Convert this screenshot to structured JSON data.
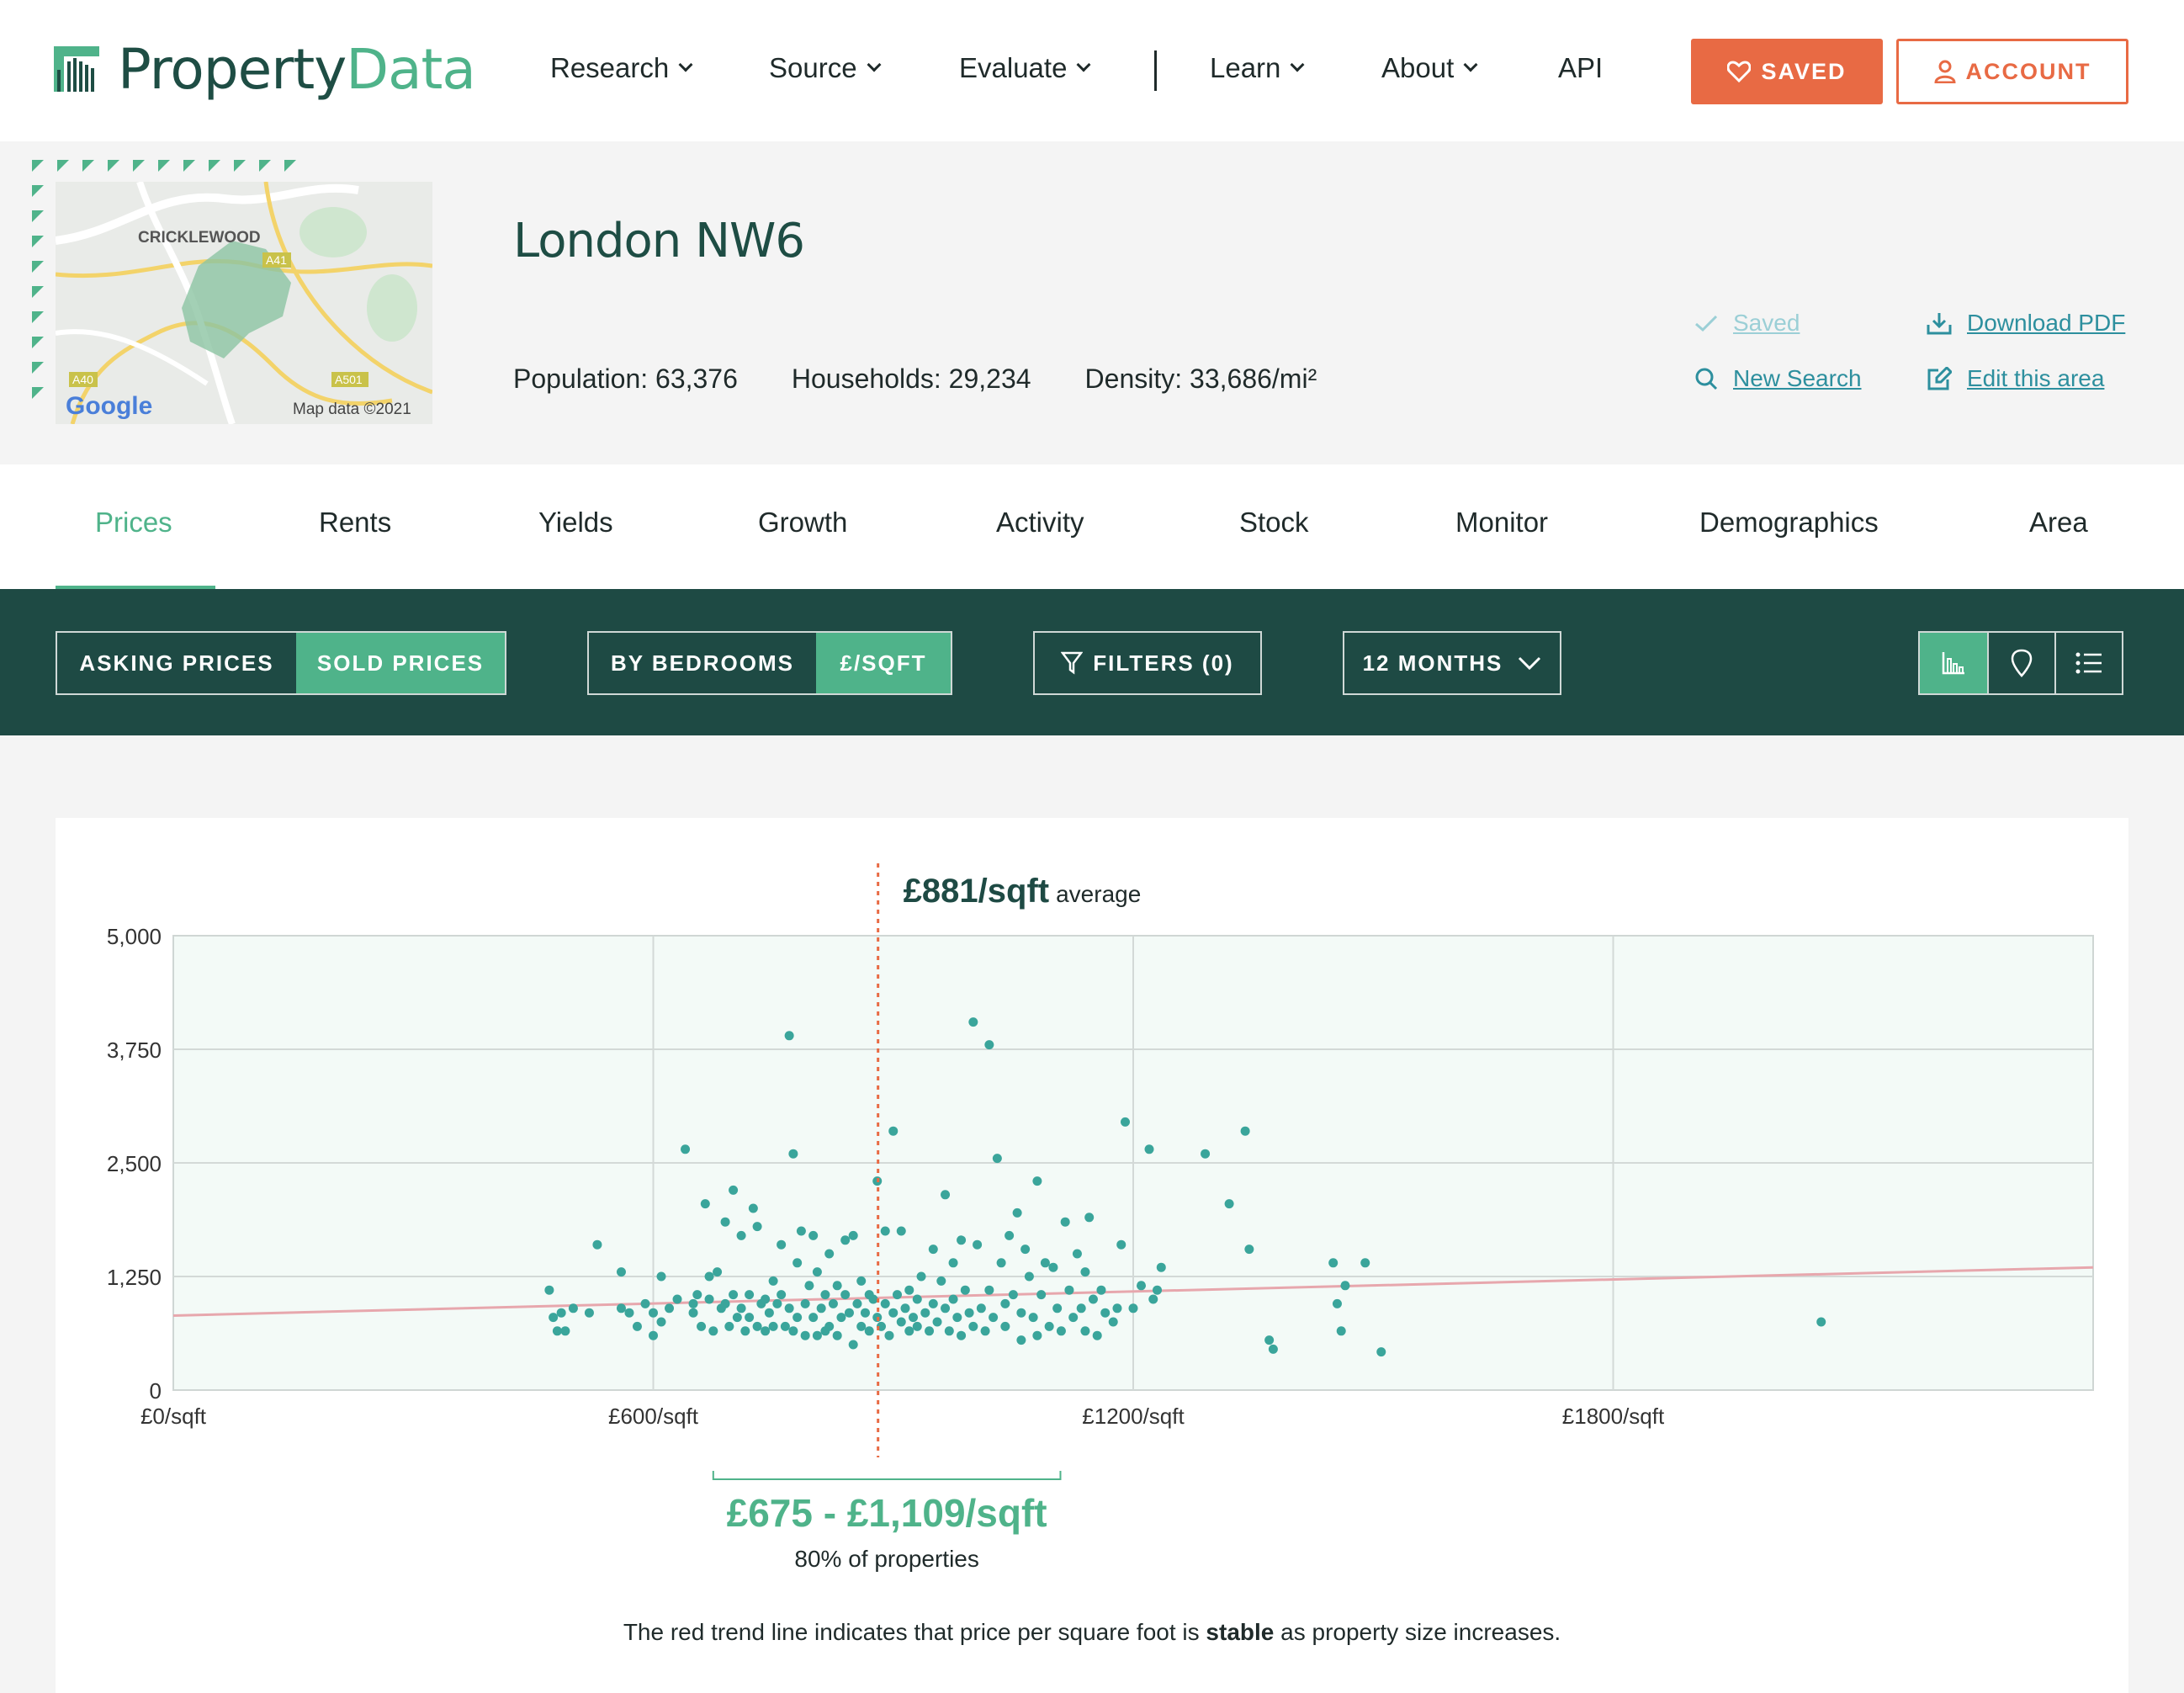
{
  "header": {
    "logo_part1": "Property",
    "logo_part2": "Data",
    "nav": [
      {
        "label": "Research",
        "has_dropdown": true
      },
      {
        "label": "Source",
        "has_dropdown": true
      },
      {
        "label": "Evaluate",
        "has_dropdown": true
      },
      {
        "label": "Learn",
        "has_dropdown": true
      },
      {
        "label": "About",
        "has_dropdown": true
      },
      {
        "label": "API",
        "has_dropdown": false
      }
    ],
    "saved_label": "SAVED",
    "account_label": "ACCOUNT",
    "accent_color": "#e86a44"
  },
  "area": {
    "title": "London NW6",
    "map_labels": {
      "place": "CRICKLEWOOD",
      "road1": "A41",
      "road2": "A40",
      "road3": "A501",
      "brand": "Google",
      "attribution": "Map data ©2021"
    },
    "stats": [
      {
        "label": "Population:",
        "value": "63,376"
      },
      {
        "label": "Households:",
        "value": "29,234"
      },
      {
        "label": "Density:",
        "value": "33,686/mi²"
      }
    ],
    "actions": {
      "saved": "Saved",
      "download_pdf": "Download PDF",
      "new_search": "New Search",
      "edit_area": "Edit this area"
    }
  },
  "tabs": [
    "Prices",
    "Rents",
    "Yields",
    "Growth",
    "Activity",
    "Stock",
    "Monitor",
    "Demographics",
    "Area"
  ],
  "active_tab": "Prices",
  "toolbar": {
    "price_type": {
      "options": [
        "ASKING PRICES",
        "SOLD PRICES"
      ],
      "selected": "SOLD PRICES"
    },
    "mode": {
      "options": [
        "BY BEDROOMS",
        "£/SQFT"
      ],
      "selected": "£/SQFT"
    },
    "filters_label": "FILTERS (0)",
    "period_label": "12 MONTHS",
    "views": [
      "chart-view-icon",
      "map-pin-icon",
      "list-view-icon"
    ],
    "active_view": "chart-view-icon",
    "bar_color": "#1e4a44",
    "active_color": "#4fb38a"
  },
  "chart": {
    "average_value": "£881/sqft",
    "average_suffix": "average",
    "range_label": "£675 - £1,109/sqft",
    "range_sub": "80% of properties",
    "trend_note_pre": "The red trend line indicates that price per square foot is ",
    "trend_note_bold": "stable",
    "trend_note_post": " as property size increases.",
    "y_ticks": [
      "5,000",
      "3,750",
      "2,500",
      "1,250",
      "0"
    ],
    "x_ticks": [
      "£0/sqft",
      "£600/sqft",
      "£1200/sqft",
      "£1800/sqft"
    ]
  },
  "chart_data": {
    "type": "scatter",
    "xlim": [
      0,
      2400
    ],
    "ylim": [
      0,
      5000
    ],
    "average_x": 881,
    "range": [
      675,
      1109
    ],
    "trend": {
      "x": [
        0,
        2400
      ],
      "y": [
        820,
        1350
      ]
    },
    "point_color": "#3aa59b",
    "trend_color": "#e7a7ad",
    "avg_line_color": "#e86a44",
    "points": [
      [
        470,
        1100
      ],
      [
        475,
        800
      ],
      [
        480,
        650
      ],
      [
        485,
        850
      ],
      [
        490,
        650
      ],
      [
        500,
        900
      ],
      [
        520,
        850
      ],
      [
        530,
        1600
      ],
      [
        560,
        1300
      ],
      [
        560,
        900
      ],
      [
        570,
        850
      ],
      [
        580,
        700
      ],
      [
        590,
        950
      ],
      [
        600,
        600
      ],
      [
        600,
        850
      ],
      [
        610,
        750
      ],
      [
        610,
        1250
      ],
      [
        620,
        900
      ],
      [
        630,
        1000
      ],
      [
        640,
        2650
      ],
      [
        650,
        950
      ],
      [
        650,
        850
      ],
      [
        655,
        1050
      ],
      [
        660,
        700
      ],
      [
        665,
        2050
      ],
      [
        670,
        1250
      ],
      [
        670,
        1000
      ],
      [
        675,
        650
      ],
      [
        680,
        1300
      ],
      [
        685,
        900
      ],
      [
        690,
        1850
      ],
      [
        690,
        950
      ],
      [
        695,
        700
      ],
      [
        700,
        1050
      ],
      [
        700,
        2200
      ],
      [
        705,
        800
      ],
      [
        710,
        1700
      ],
      [
        710,
        900
      ],
      [
        715,
        650
      ],
      [
        720,
        1050
      ],
      [
        720,
        800
      ],
      [
        725,
        2000
      ],
      [
        730,
        1800
      ],
      [
        730,
        700
      ],
      [
        735,
        950
      ],
      [
        740,
        1000
      ],
      [
        740,
        650
      ],
      [
        745,
        850
      ],
      [
        750,
        1200
      ],
      [
        750,
        700
      ],
      [
        755,
        950
      ],
      [
        760,
        1600
      ],
      [
        760,
        1050
      ],
      [
        765,
        700
      ],
      [
        770,
        900
      ],
      [
        770,
        3900
      ],
      [
        775,
        2600
      ],
      [
        775,
        650
      ],
      [
        780,
        1400
      ],
      [
        780,
        800
      ],
      [
        785,
        1750
      ],
      [
        790,
        600
      ],
      [
        790,
        950
      ],
      [
        795,
        1150
      ],
      [
        800,
        800
      ],
      [
        800,
        1700
      ],
      [
        805,
        1300
      ],
      [
        805,
        600
      ],
      [
        810,
        900
      ],
      [
        815,
        650
      ],
      [
        815,
        1050
      ],
      [
        820,
        1500
      ],
      [
        820,
        700
      ],
      [
        825,
        950
      ],
      [
        830,
        1150
      ],
      [
        830,
        600
      ],
      [
        835,
        800
      ],
      [
        840,
        1650
      ],
      [
        840,
        1050
      ],
      [
        845,
        850
      ],
      [
        850,
        1700
      ],
      [
        850,
        500
      ],
      [
        855,
        950
      ],
      [
        860,
        700
      ],
      [
        860,
        1200
      ],
      [
        865,
        850
      ],
      [
        870,
        1050
      ],
      [
        870,
        650
      ],
      [
        875,
        1000
      ],
      [
        880,
        800
      ],
      [
        880,
        2300
      ],
      [
        885,
        700
      ],
      [
        890,
        1750
      ],
      [
        890,
        950
      ],
      [
        895,
        600
      ],
      [
        900,
        850
      ],
      [
        900,
        2850
      ],
      [
        905,
        1050
      ],
      [
        910,
        750
      ],
      [
        910,
        1750
      ],
      [
        915,
        900
      ],
      [
        920,
        650
      ],
      [
        920,
        1100
      ],
      [
        925,
        800
      ],
      [
        930,
        1000
      ],
      [
        930,
        700
      ],
      [
        935,
        1250
      ],
      [
        940,
        850
      ],
      [
        945,
        650
      ],
      [
        950,
        950
      ],
      [
        950,
        1550
      ],
      [
        955,
        750
      ],
      [
        960,
        1200
      ],
      [
        965,
        900
      ],
      [
        965,
        2150
      ],
      [
        970,
        650
      ],
      [
        975,
        1400
      ],
      [
        975,
        1000
      ],
      [
        980,
        800
      ],
      [
        985,
        1650
      ],
      [
        985,
        600
      ],
      [
        990,
        1100
      ],
      [
        995,
        850
      ],
      [
        1000,
        700
      ],
      [
        1000,
        4050
      ],
      [
        1005,
        1600
      ],
      [
        1010,
        900
      ],
      [
        1015,
        650
      ],
      [
        1020,
        1100
      ],
      [
        1020,
        3800
      ],
      [
        1025,
        800
      ],
      [
        1030,
        2550
      ],
      [
        1035,
        1400
      ],
      [
        1040,
        950
      ],
      [
        1040,
        700
      ],
      [
        1045,
        1700
      ],
      [
        1050,
        1050
      ],
      [
        1055,
        1950
      ],
      [
        1060,
        850
      ],
      [
        1060,
        550
      ],
      [
        1065,
        1550
      ],
      [
        1070,
        1250
      ],
      [
        1075,
        800
      ],
      [
        1080,
        2300
      ],
      [
        1080,
        600
      ],
      [
        1085,
        1050
      ],
      [
        1090,
        1400
      ],
      [
        1095,
        700
      ],
      [
        1100,
        1350
      ],
      [
        1105,
        900
      ],
      [
        1110,
        650
      ],
      [
        1115,
        1850
      ],
      [
        1120,
        1100
      ],
      [
        1125,
        800
      ],
      [
        1130,
        1500
      ],
      [
        1135,
        900
      ],
      [
        1140,
        1300
      ],
      [
        1140,
        650
      ],
      [
        1145,
        1900
      ],
      [
        1150,
        1000
      ],
      [
        1155,
        600
      ],
      [
        1160,
        1100
      ],
      [
        1165,
        850
      ],
      [
        1175,
        750
      ],
      [
        1180,
        900
      ],
      [
        1185,
        1600
      ],
      [
        1190,
        2950
      ],
      [
        1200,
        900
      ],
      [
        1210,
        1150
      ],
      [
        1220,
        2650
      ],
      [
        1225,
        1000
      ],
      [
        1230,
        1100
      ],
      [
        1235,
        1350
      ],
      [
        1290,
        2600
      ],
      [
        1320,
        2050
      ],
      [
        1340,
        2850
      ],
      [
        1345,
        1550
      ],
      [
        1370,
        550
      ],
      [
        1375,
        450
      ],
      [
        1450,
        1400
      ],
      [
        1455,
        950
      ],
      [
        1460,
        650
      ],
      [
        1465,
        1150
      ],
      [
        1490,
        1400
      ],
      [
        1510,
        420
      ],
      [
        2060,
        750
      ]
    ]
  }
}
